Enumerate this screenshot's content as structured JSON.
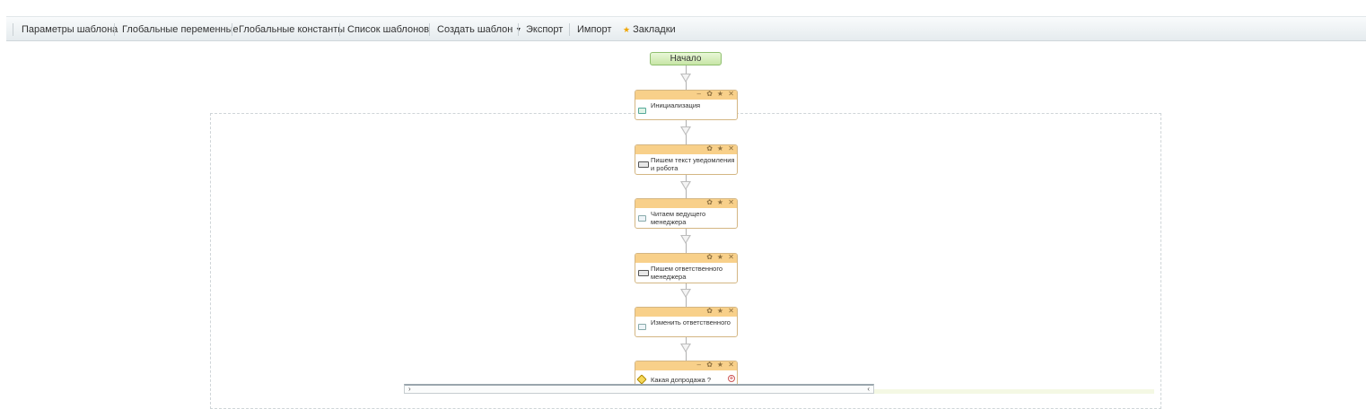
{
  "toolbar": {
    "items": [
      {
        "label": "Параметры шаблона"
      },
      {
        "label": "Глобальные переменные"
      },
      {
        "label": "Глобальные константы"
      },
      {
        "label": "Список шаблонов"
      },
      {
        "label": "Создать шаблон"
      },
      {
        "label": "Экспорт"
      },
      {
        "label": "Импорт"
      },
      {
        "label": "Закладки",
        "icon": "star-icon"
      }
    ]
  },
  "workflow": {
    "start_label": "Начало",
    "blocks": [
      {
        "label": "Инициализация",
        "icon": "init-icon",
        "controls": [
          "minimize",
          "settings",
          "favorite",
          "close"
        ]
      },
      {
        "label": "Пишем текст уведомления и робота",
        "icon": "write-icon",
        "controls": [
          "settings",
          "favorite",
          "close"
        ]
      },
      {
        "label": "Читаем ведущего менеджера",
        "icon": "read-icon",
        "controls": [
          "settings",
          "favorite",
          "close"
        ]
      },
      {
        "label": "Пишем ответственного менеджера",
        "icon": "write-icon",
        "controls": [
          "settings",
          "favorite",
          "close"
        ]
      },
      {
        "label": "Изменить ответственного",
        "icon": "change-icon",
        "controls": [
          "settings",
          "favorite",
          "close"
        ]
      },
      {
        "label": "Какая допродажа ?",
        "icon": "condition-icon",
        "controls": [
          "minimize",
          "settings",
          "favorite",
          "close"
        ]
      }
    ]
  },
  "colors": {
    "block_header": "#f8d08a",
    "start_fill": "#c7e6a6"
  }
}
